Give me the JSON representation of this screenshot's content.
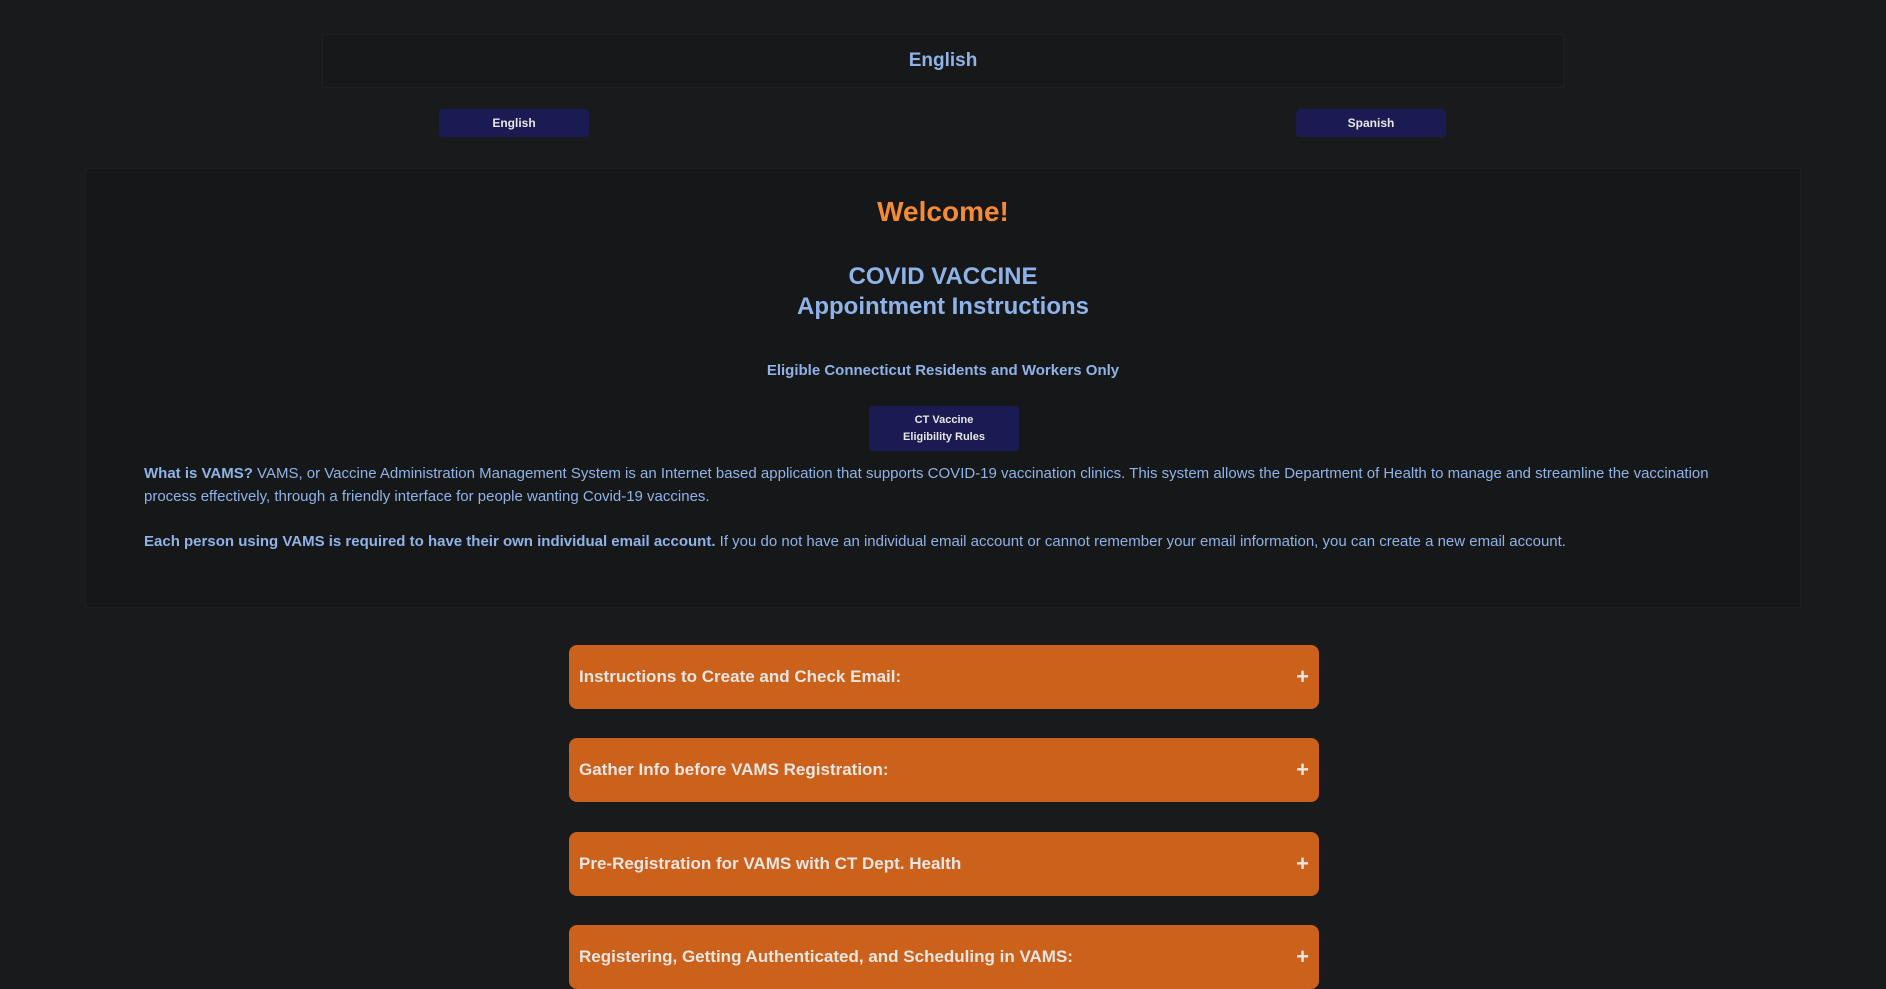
{
  "language_header": {
    "title": "English"
  },
  "language_buttons": {
    "english": "English",
    "spanish": "Spanish"
  },
  "welcome": {
    "title": "Welcome!",
    "subtitle_line1": "COVID VACCINE",
    "subtitle_line2": "Appointment Instructions",
    "eligibility_note": "Eligible Connecticut Residents and Workers Only",
    "rules_button_line1": "CT Vaccine",
    "rules_button_line2": "Eligibility Rules",
    "vams_question": "What is VAMS?",
    "vams_text": " VAMS, or Vaccine Administration Management System is an Internet based application that supports COVID-19 vaccination clinics. This system allows the Department of Health to manage and streamline the vaccination process effectively, through a friendly interface for people wanting Covid-19 vaccines.",
    "email_requirement": "Each person using VAMS is required to have their own individual email account.",
    "email_text": " If you do not have an individual email account or cannot remember your email information, you can create a new email account."
  },
  "accordions": [
    {
      "label": "Instructions to Create and Check Email:",
      "icon": "plus-icon"
    },
    {
      "label": "Gather Info before VAMS Registration:",
      "icon": "plus-icon"
    },
    {
      "label": "Pre-Registration for VAMS with CT Dept. Health",
      "icon": "plus-icon"
    },
    {
      "label": "Registering, Getting Authenticated, and Scheduling in VAMS:",
      "icon": "plus-icon"
    }
  ],
  "symbols": {
    "plus": "+"
  },
  "colors": {
    "background": "#181a1b",
    "accent_orange": "#f58b36",
    "accordion_bg": "#cc611b",
    "link_blue": "#8fb3e8",
    "button_navy": "#1b1b54"
  }
}
